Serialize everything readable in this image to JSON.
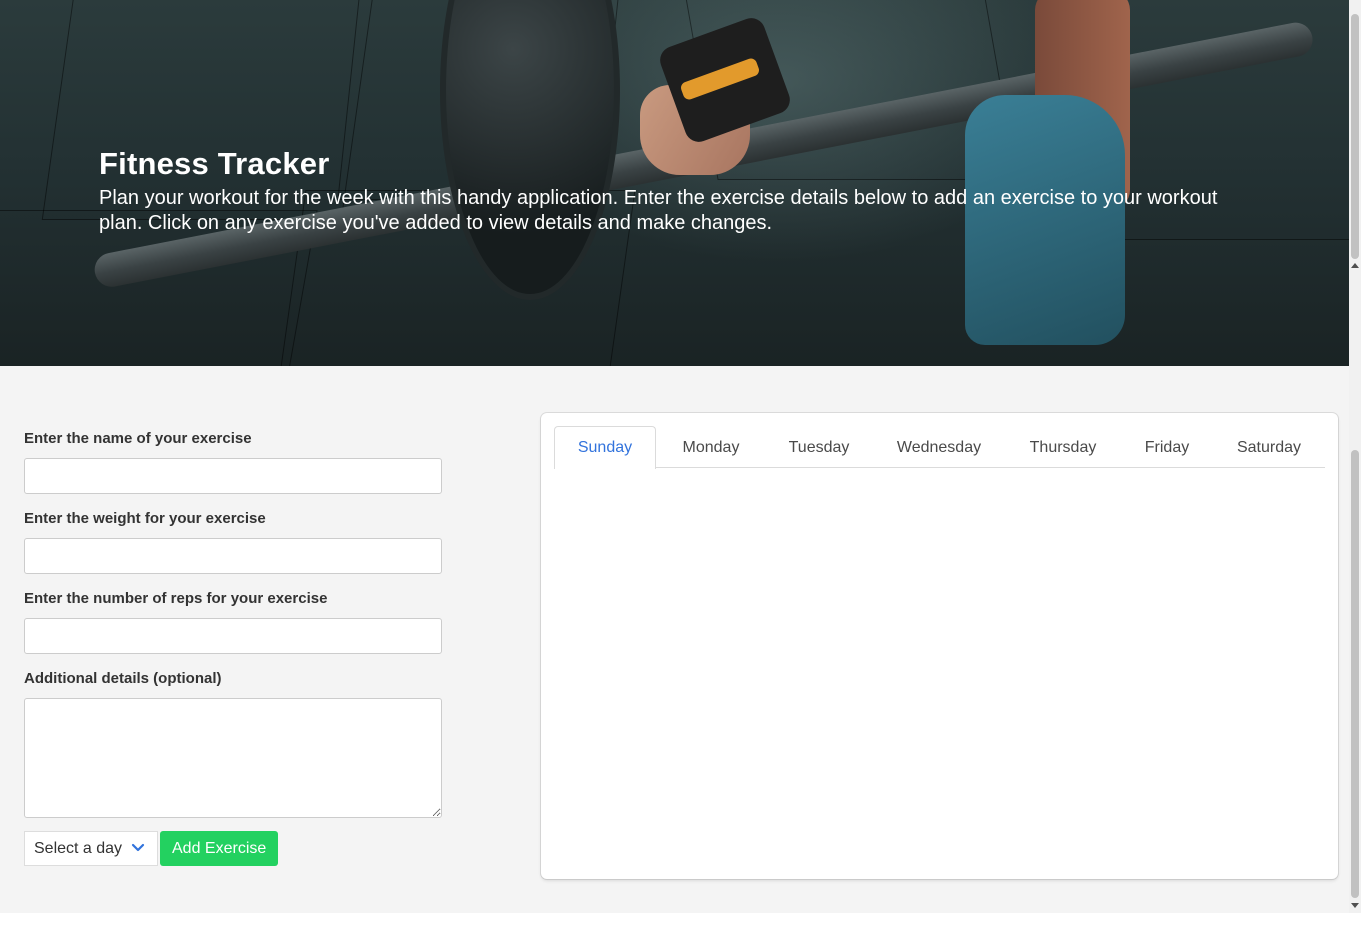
{
  "hero": {
    "title": "Fitness Tracker",
    "description": "Plan your workout for the week with this handy application. Enter the exercise details below to add an exercise to your workout plan. Click on any exercise you've added to view details and make changes."
  },
  "form": {
    "name_label": "Enter the name of your exercise",
    "name_value": "",
    "weight_label": "Enter the weight for your exercise",
    "weight_value": "",
    "reps_label": "Enter the number of reps for your exercise",
    "reps_value": "",
    "details_label": "Additional details (optional)",
    "details_value": "",
    "day_select": {
      "selected": "Select a day"
    },
    "add_button": "Add Exercise"
  },
  "tabs": [
    {
      "label": "Sunday",
      "active": true
    },
    {
      "label": "Monday",
      "active": false
    },
    {
      "label": "Tuesday",
      "active": false
    },
    {
      "label": "Wednesday",
      "active": false
    },
    {
      "label": "Thursday",
      "active": false
    },
    {
      "label": "Friday",
      "active": false
    },
    {
      "label": "Saturday",
      "active": false
    }
  ],
  "colors": {
    "accent_blue": "#3273dc",
    "success_green": "#23d160",
    "background": "#f4f4f4"
  }
}
